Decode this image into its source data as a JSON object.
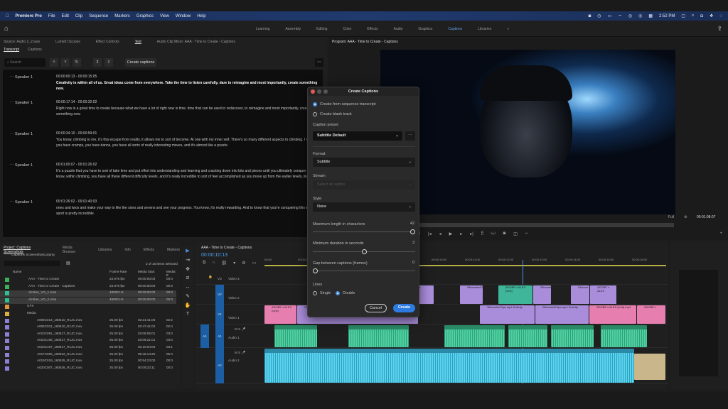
{
  "menubar": {
    "app": "Premiere Pro",
    "items": [
      "File",
      "Edit",
      "Clip",
      "Sequence",
      "Markers",
      "Graphics",
      "View",
      "Window",
      "Help"
    ],
    "time": "2:52 PM"
  },
  "workspaces": {
    "items": [
      "Learning",
      "Assembly",
      "Editing",
      "Color",
      "Effects",
      "Audio",
      "Graphics",
      "Captions",
      "Libraries"
    ],
    "active": "Captions"
  },
  "source_panel": {
    "tabs": [
      "Source: Audio 2_2.wav",
      "Lumetri Scopes",
      "Effect Controls",
      "Text",
      "Audio Clip Mixer: AAA - Time to Create - Captions"
    ],
    "subtabs": [
      "Transcript",
      "Captions"
    ],
    "search_placeholder": "Search",
    "create_captions": "Create captions"
  },
  "transcript": [
    {
      "speaker": "Speaker 1",
      "timecode": "00:00:00:13 - 00:00:15:05",
      "text": "Creativity is within all of us. Great ideas come from everywhere. Take the time to listen carefully, dare to reimagine and most importantly, create something new."
    },
    {
      "speaker": "Speaker 1",
      "timecode": "00:00:17:14 - 00:00:32:02",
      "text": "Right now is a great time to create because what we have a lot of right now is time, time that can be used to rediscover, to reimagine and most importantly, create something new."
    },
    {
      "speaker": "Speaker 1",
      "timecode": "00:00:34:10 - 00:00:59:01",
      "text": "You know, climbing to me, it's this escape from reality, it allows me to sort of become. At one with my inner self. There's so many different aspects to climbing. I mean, you have cramps, you have danos, you have all sorts of really interesting moves, and it's almost like a puzzle."
    },
    {
      "speaker": "Speaker 1",
      "timecode": "00:01:00:07 - 00:01:26:02",
      "text": "It's a puzzle that you have to sort of take time and put effort into understanding and learning and cracking down into bits and pieces until you ultimately conquer it. You know, within climbing, you have all these different difficulty levels, and it's really incredible to sort of feel accomplished as you move up from the earlier levels, like the"
    },
    {
      "speaker": "Speaker 1",
      "timecode": "00:01:26:02 - 00:01:40:03",
      "text": "ones and twos and make your way to like the sixes and sevens and see your progress. You know, it's really rewarding. And to know that you're conquering this world of sport is pretty incredible."
    }
  ],
  "program": {
    "title": "Program: AAA - Time to Create - Captions",
    "zoom": "Full",
    "timecode": "00:01:08:07"
  },
  "dialog": {
    "title": "Create Captions",
    "source_options": [
      "Create from sequence transcript",
      "Create blank track"
    ],
    "source_selected": 0,
    "caption_preset_label": "Caption preset",
    "caption_preset": "Subtitle Default",
    "format_label": "Format",
    "format": "Subtitle",
    "stream_label": "Stream",
    "stream_placeholder": "Select an option",
    "style_label": "Style",
    "style": "None",
    "max_length_label": "Maximum length in characters",
    "max_length": 42,
    "min_duration_label": "Minimum duration in seconds",
    "min_duration": 3,
    "gap_label": "Gap between captions (frames)",
    "gap": 0,
    "lines_label": "Lines",
    "lines_options": [
      "Single",
      "Double"
    ],
    "lines_selected": 1,
    "cancel": "Cancel",
    "create": "Create"
  },
  "project": {
    "tabs": [
      "Project: Captions Screenshots",
      "Media Browser",
      "Libraries",
      "Info",
      "Effects",
      "Markers"
    ],
    "file": "Captions Screenshots.prproj",
    "selection": "2 of 16 items selected",
    "columns": [
      "Name",
      "Frame Rate",
      "Media Start",
      "Media E"
    ],
    "rows": [
      {
        "name": "AAA - Time to Create",
        "rate": "23.976 fps",
        "start": "00:00:00:00",
        "end": "00:0",
        "color": "#3fae5a"
      },
      {
        "name": "AAA - Time to Create - Captions",
        "rate": "23.976 fps",
        "start": "00:00:00:00",
        "end": "00:0",
        "color": "#3fae5a"
      },
      {
        "name": "climber_VO_1.m4a",
        "rate": "48000 Hz",
        "start": "00:00:00:00",
        "end": "00:0",
        "color": "#2fbf94",
        "sel": true
      },
      {
        "name": "climber_VO_2.m4a",
        "rate": "48000 Hz",
        "start": "00:00:00:00",
        "end": "00:0",
        "color": "#2fbf94",
        "sel": true
      },
      {
        "name": "GFX",
        "rate": "",
        "start": "",
        "end": "",
        "color": "#e0953a"
      },
      {
        "name": "Media",
        "rate": "",
        "start": "",
        "end": "",
        "color": "#d8b040"
      },
      {
        "name": "A006C014_160510_R1JC.mov",
        "rate": "25.00 fps",
        "start": "02:21:41:06",
        "end": "02:2",
        "color": "#8c7fd6"
      },
      {
        "name": "A006C021_160510_R1JC.mov",
        "rate": "25.00 fps",
        "start": "02:47:41:02",
        "end": "02:4",
        "color": "#8c7fd6"
      },
      {
        "name": "A010C091_160517_R1JC.mov",
        "rate": "25.00 fps",
        "start": "03:05:05:01",
        "end": "03:0",
        "color": "#8c7fd6"
      },
      {
        "name": "A010C105_160517_R1JC.mov",
        "rate": "25.00 fps",
        "start": "03:09:21:01",
        "end": "03:0",
        "color": "#8c7fd6"
      },
      {
        "name": "A010C107_160517_R1JC.mov",
        "rate": "25.00 fps",
        "start": "03:10:04:05",
        "end": "03:1",
        "color": "#8c7fd6"
      },
      {
        "name": "A017C006_160522_R1JC.mov",
        "rate": "25.00 fps",
        "start": "06:46:14:20",
        "end": "06:4",
        "color": "#8c7fd6"
      },
      {
        "name": "A019C019_160525_R1JC.mov",
        "rate": "25.00 fps",
        "start": "00:54:23:00",
        "end": "00:0",
        "color": "#8c7fd6"
      },
      {
        "name": "A020C007_160526_R1JC.mov",
        "rate": "25.00 fps",
        "start": "00:09:23:11",
        "end": "00:0",
        "color": "#8c7fd6"
      }
    ]
  },
  "timeline": {
    "title": "AAA - Time to Create - Captions",
    "timecode": "00:00:10:13",
    "ruler": [
      "00:00",
      "00:00:01:00",
      "00:00:07:00",
      "00:00:08:00",
      "00:00:09:00",
      "00:00:10:00",
      "00:00:11:00",
      "00:00:12:00",
      "00:00:13:00",
      "00:00:14:00",
      "00:00:15:00",
      "00:00:16:00"
    ],
    "tracks": [
      "Video 3",
      "Video 2",
      "Video 1",
      "Audio 1",
      "Audio 2"
    ],
    "track_ids": [
      "V3",
      "V2",
      "V1",
      "A1",
      "A2"
    ],
    "clips_v2": [
      "SilhouetteClips",
      "SilhouetteClips",
      "ADOBE x ALEX (Unit)",
      "SilhouetteClips",
      "Silhouet",
      "ADOBE x ALEX"
    ],
    "clips_v1": [
      "ADOBE x ALEX (Unit)",
      "SilhouetteClips.mp4 Subclip",
      "SilhouetteClips.mp4 Subclip",
      "SilhouetteClips.mp4 Subclip",
      "ADOBE x ALEX (Unit).mp4",
      "ADOBE x"
    ],
    "colors": {
      "video": "#a98ddb",
      "pink": "#e67fb0",
      "audio1": "#3fc597",
      "audio2": "#4ac6e6",
      "accent": "#2d7be0"
    }
  }
}
